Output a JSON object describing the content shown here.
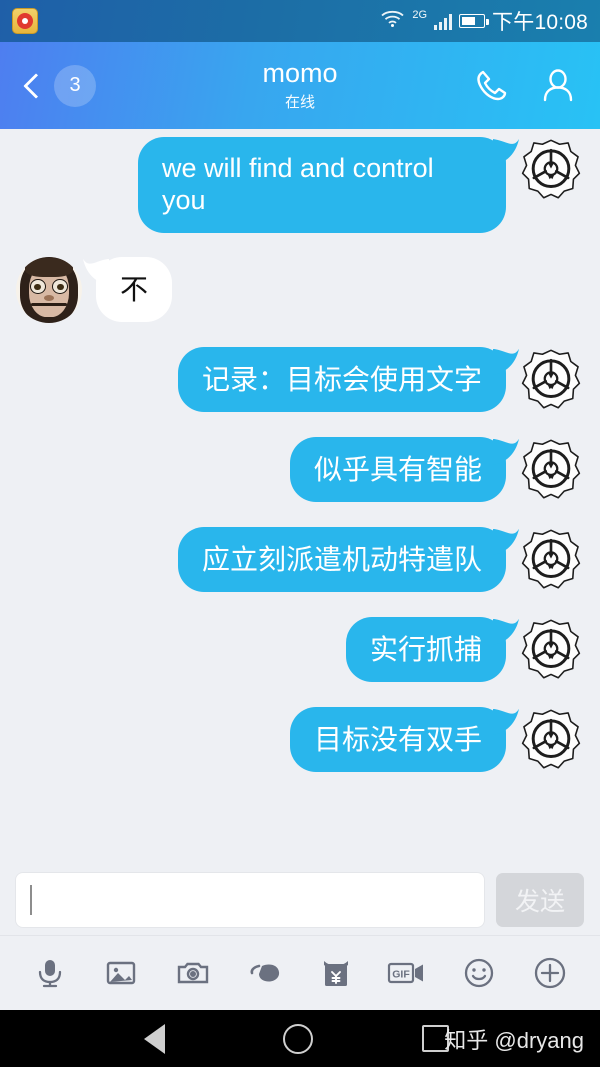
{
  "statusbar": {
    "notification_icon": "weibo-icon",
    "network_label": "2G",
    "time": "下午10:08"
  },
  "header": {
    "back_icon": "chevron-left-icon",
    "unread_count": "3",
    "title": "momo",
    "subtitle": "在线",
    "call_icon": "phone-icon",
    "profile_icon": "person-icon"
  },
  "messages": [
    {
      "side": "out",
      "text": "we will find and control you",
      "avatar": "scp-logo",
      "lang": "en"
    },
    {
      "side": "in",
      "text": "不",
      "avatar": "momo-face",
      "lang": "zh"
    },
    {
      "side": "out",
      "text": "记录：目标会使用文字",
      "avatar": "scp-logo",
      "lang": "zh"
    },
    {
      "side": "out",
      "text": "似乎具有智能",
      "avatar": "scp-logo",
      "lang": "zh"
    },
    {
      "side": "out",
      "text": "应立刻派遣机动特遣队",
      "avatar": "scp-logo",
      "lang": "zh"
    },
    {
      "side": "out",
      "text": "实行抓捕",
      "avatar": "scp-logo",
      "lang": "zh"
    },
    {
      "side": "out",
      "text": "目标没有双手",
      "avatar": "scp-logo",
      "lang": "zh"
    }
  ],
  "composer": {
    "input_value": "",
    "input_placeholder": "",
    "send_label": "发送"
  },
  "tools": [
    {
      "name": "microphone-icon"
    },
    {
      "name": "image-icon"
    },
    {
      "name": "camera-icon"
    },
    {
      "name": "poke-hand-icon"
    },
    {
      "name": "red-envelope-icon"
    },
    {
      "name": "gif-video-icon"
    },
    {
      "name": "emoji-icon"
    },
    {
      "name": "plus-icon"
    }
  ],
  "navbar": {
    "back_icon": "android-back-icon",
    "home_icon": "android-home-icon",
    "recents_icon": "android-recents-icon",
    "watermark": "知乎 @dryang"
  },
  "colors": {
    "bubble_blue": "#29b6ec",
    "chat_bg": "#eef0f4",
    "header_start": "#4e7ef0",
    "header_end": "#28c2f5",
    "statusbar_bg": "#1f5fa8",
    "send_disabled": "#d4d6da"
  }
}
